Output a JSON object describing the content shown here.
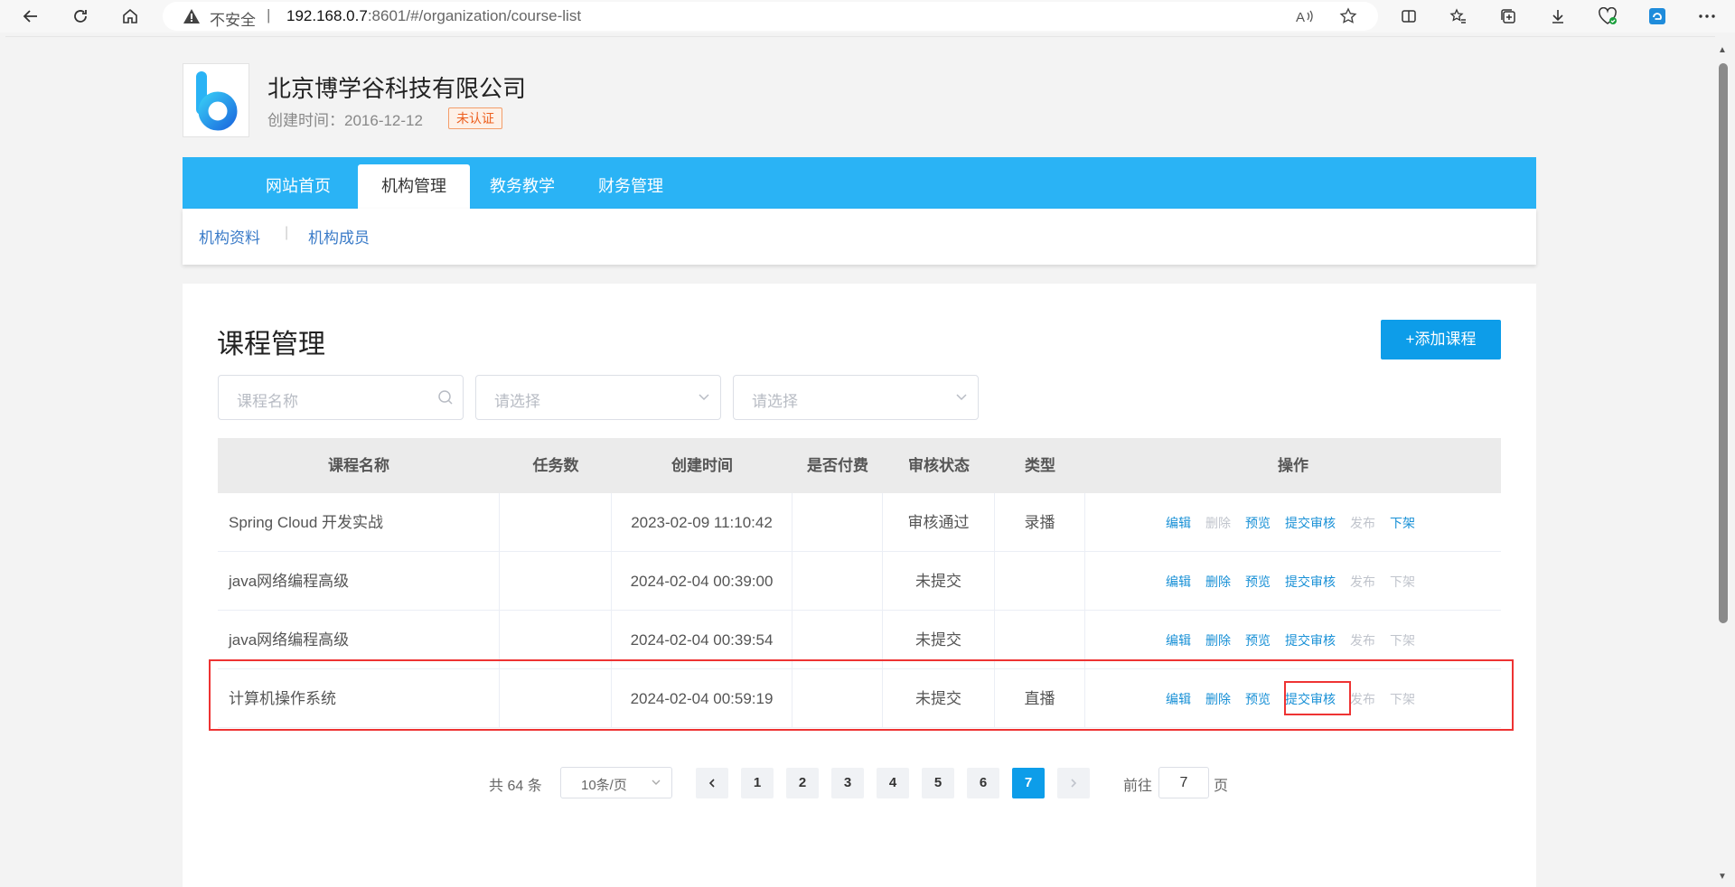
{
  "browser": {
    "insecure_label": "不安全",
    "separator": "|",
    "url_host": "192.168.0.7",
    "url_path": ":8601/#/organization/course-list"
  },
  "org": {
    "name": "北京博学谷科技有限公司",
    "created": "创建时间：2016-12-12",
    "badge": "未认证"
  },
  "top_nav": [
    {
      "label": "网站首页",
      "active": false
    },
    {
      "label": "机构管理",
      "active": true
    },
    {
      "label": "教务教学",
      "active": false
    },
    {
      "label": "财务管理",
      "active": false
    }
  ],
  "sub_nav": [
    "机构资料",
    "机构成员"
  ],
  "page": {
    "title": "课程管理",
    "add_button": "+添加课程"
  },
  "filters": {
    "course_name_placeholder": "课程名称",
    "select1_placeholder": "请选择",
    "select2_placeholder": "请选择"
  },
  "table": {
    "headers": [
      "课程名称",
      "任务数",
      "创建时间",
      "是否付费",
      "审核状态",
      "类型",
      "操作"
    ],
    "rows": [
      {
        "name": "Spring Cloud 开发实战",
        "tasks": "",
        "created": "2023-02-09 11:10:42",
        "paid": "",
        "status": "审核通过",
        "type": "录播",
        "ops": [
          {
            "label": "编辑",
            "enabled": true
          },
          {
            "label": "删除",
            "enabled": false
          },
          {
            "label": "预览",
            "enabled": true
          },
          {
            "label": "提交审核",
            "enabled": true
          },
          {
            "label": "发布",
            "enabled": false
          },
          {
            "label": "下架",
            "enabled": true
          }
        ]
      },
      {
        "name": "java网络编程高级",
        "tasks": "",
        "created": "2024-02-04 00:39:00",
        "paid": "",
        "status": "未提交",
        "type": "",
        "ops": [
          {
            "label": "编辑",
            "enabled": true
          },
          {
            "label": "删除",
            "enabled": true
          },
          {
            "label": "预览",
            "enabled": true
          },
          {
            "label": "提交审核",
            "enabled": true
          },
          {
            "label": "发布",
            "enabled": false
          },
          {
            "label": "下架",
            "enabled": false
          }
        ]
      },
      {
        "name": "java网络编程高级",
        "tasks": "",
        "created": "2024-02-04 00:39:54",
        "paid": "",
        "status": "未提交",
        "type": "",
        "ops": [
          {
            "label": "编辑",
            "enabled": true
          },
          {
            "label": "删除",
            "enabled": true
          },
          {
            "label": "预览",
            "enabled": true
          },
          {
            "label": "提交审核",
            "enabled": true
          },
          {
            "label": "发布",
            "enabled": false
          },
          {
            "label": "下架",
            "enabled": false
          }
        ]
      },
      {
        "name": "计算机操作系统",
        "tasks": "",
        "created": "2024-02-04 00:59:19",
        "paid": "",
        "status": "未提交",
        "type": "直播",
        "ops": [
          {
            "label": "编辑",
            "enabled": true
          },
          {
            "label": "删除",
            "enabled": true
          },
          {
            "label": "预览",
            "enabled": true
          },
          {
            "label": "提交审核",
            "enabled": true
          },
          {
            "label": "发布",
            "enabled": false
          },
          {
            "label": "下架",
            "enabled": false
          }
        ]
      }
    ]
  },
  "pagination": {
    "total": "共 64 条",
    "page_size": "10条/页",
    "pages": [
      "1",
      "2",
      "3",
      "4",
      "5",
      "6",
      "7"
    ],
    "current": "7",
    "goto_label": "前往",
    "goto_value": "7",
    "page_suffix": "页"
  },
  "colors": {
    "nav_blue": "#2ab3f5",
    "primary": "#0d9de9",
    "link_blue": "#1890d6",
    "highlight_red": "#e33333",
    "badge_orange": "#ed5f1e"
  }
}
